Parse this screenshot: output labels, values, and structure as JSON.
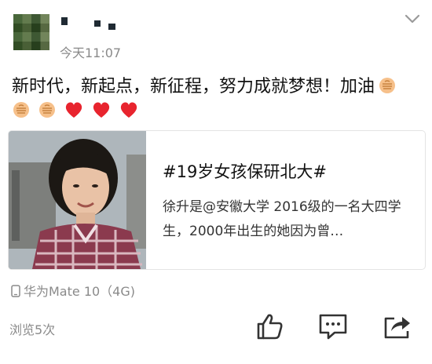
{
  "post": {
    "author_name": "",
    "time": "今天11:07",
    "text": "新时代，新起点，新征程，努力成就梦想！加油"
  },
  "emojis": [
    "fist-icon",
    "fist-icon",
    "fist-icon",
    "heart-icon",
    "heart-icon",
    "heart-icon"
  ],
  "card": {
    "title": "#19岁女孩保研北大#",
    "description": "徐升是@安徽大学 2016级的一名大四学生，2000年出生的她因为曾…"
  },
  "device": "华为Mate 10（4G)",
  "views": "浏览5次",
  "colors": {
    "heart": "#e8242e",
    "meta_gray": "#8a8a8a",
    "icon_dark": "#333333"
  }
}
